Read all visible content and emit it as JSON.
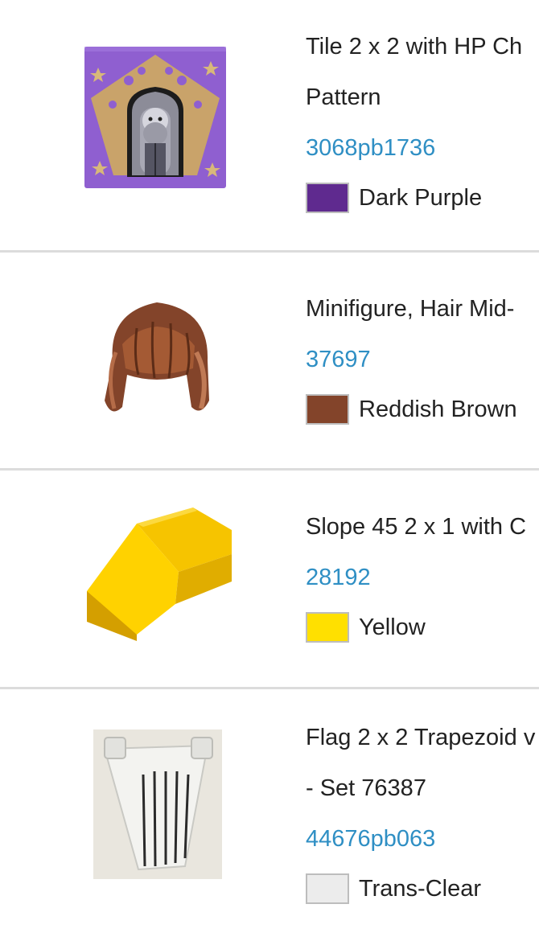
{
  "items": [
    {
      "name_lines": [
        "Tile 2 x 2 with HP Ch",
        "Pattern"
      ],
      "part_number": "3068pb1736",
      "color_name": "Dark Purple",
      "color_hex": "#5f2a8f",
      "image": "chocolate-frog-card-tile-icon"
    },
    {
      "name_lines": [
        "Minifigure, Hair Mid-"
      ],
      "part_number": "37697",
      "color_name": "Reddish Brown",
      "color_hex": "#83442a",
      "image": "minifigure-hair-icon"
    },
    {
      "name_lines": [
        "Slope 45 2 x 1 with C"
      ],
      "part_number": "28192",
      "color_name": "Yellow",
      "color_hex": "#ffe000",
      "image": "yellow-slope-brick-icon"
    },
    {
      "name_lines": [
        "Flag 2 x 2 Trapezoid v",
        "- Set 76387"
      ],
      "part_number": "44676pb063",
      "color_name": "Trans-Clear",
      "color_hex": "#ececec",
      "image": "trans-clear-flag-icon"
    }
  ]
}
